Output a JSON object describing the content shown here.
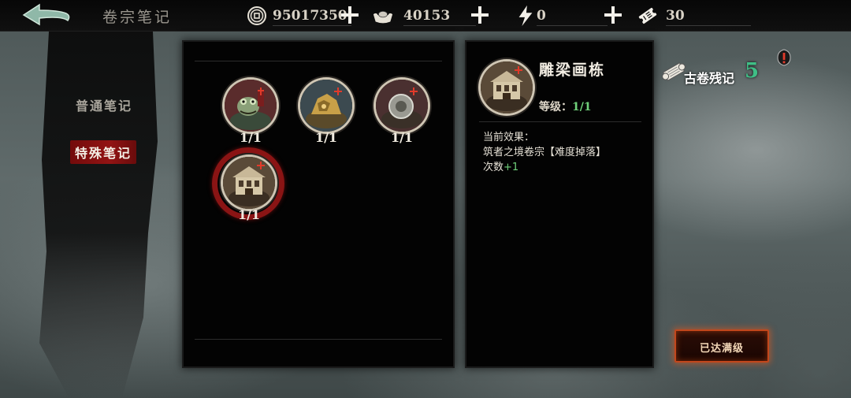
{
  "header": {
    "title": "卷宗笔记",
    "resources": [
      {
        "icon": "copper-coin-icon",
        "value": "95017350"
      },
      {
        "icon": "silver-ingot-icon",
        "value": "40153"
      },
      {
        "icon": "lightning-icon",
        "value": "0"
      },
      {
        "icon": "ticket-icon",
        "value": "30"
      }
    ]
  },
  "categories": [
    {
      "label": "普通笔记",
      "active": false
    },
    {
      "label": "特殊笔记",
      "active": true
    }
  ],
  "notes": [
    {
      "count": "1/1",
      "icon": "frog-scholar-icon",
      "selected": false
    },
    {
      "count": "1/1",
      "icon": "golden-treasure-icon",
      "selected": false
    },
    {
      "count": "1/1",
      "icon": "stone-disc-icon",
      "selected": false
    },
    {
      "count": "1/1",
      "icon": "carved-pavilion-icon",
      "selected": true
    }
  ],
  "detail": {
    "name": "雕梁画栋",
    "level_label": "等级：",
    "level_value": "1/1",
    "effect_label": "当前效果：",
    "effect_line1": "筑者之境卷宗【难度掉落】",
    "effect_line2_prefix": "次数",
    "effect_line2_bonus": "+1"
  },
  "scroll": {
    "label": "古卷残记",
    "count": "5"
  },
  "max_button": {
    "label": "已达满级"
  },
  "colors": {
    "accent_green": "#6fd07a",
    "scroll_green": "#3fbf86",
    "active_red": "#8a1414",
    "button_border": "#c2471c"
  }
}
